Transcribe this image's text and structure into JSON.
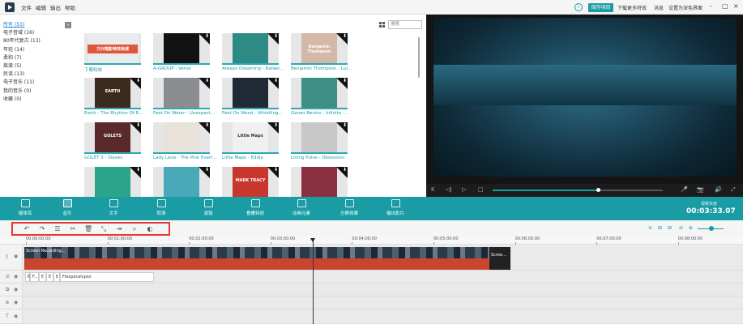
{
  "titlebar": {
    "menu": [
      "文件",
      "编辑",
      "输出",
      "帮助"
    ],
    "info_icon": "i",
    "save_button": "保存项目",
    "links": [
      "下载更多特效",
      "消息",
      "设置为深色界面"
    ],
    "window_controls": [
      "-",
      "□",
      "×"
    ]
  },
  "library": {
    "categories": [
      "所有 (53)",
      "电子音域 (16)",
      "80年代复古 (13)",
      "年轻 (14)",
      "柔和 (7)",
      "摇滚 (5)",
      "民谣 (13)",
      "电子音乐 (11)",
      "我的音乐 (0)",
      "收藏 (0)"
    ],
    "collapse": "«",
    "search_placeholder": "搜索",
    "cards": [
      {
        "title": "下载特效",
        "cover": "万兴喵影特效商城",
        "color": "#e9ecec",
        "download": false
      },
      {
        "title": "A-GROUP - Verve",
        "cover": "",
        "color": "#121212",
        "download": true
      },
      {
        "title": "Always Dreaming - Rafael...",
        "cover": "",
        "color": "#2d8a84",
        "download": true
      },
      {
        "title": "Benjamin Thompson - Lul...",
        "cover": "Benjamin Thompson",
        "color": "#d3b8a8",
        "download": true
      },
      {
        "title": "Earth - The Rhythm Of R...",
        "cover": "EARTH",
        "color": "#3b2a1e",
        "download": true
      },
      {
        "title": "Feet On Water - Unexpect...",
        "cover": "",
        "color": "#8a8e90",
        "download": true
      },
      {
        "title": "Feet On Wood - Whistling...",
        "cover": "",
        "color": "#1f2a36",
        "download": true
      },
      {
        "title": "Garret Bevins - Infinite -...",
        "cover": "",
        "color": "#3c8e86",
        "download": true
      },
      {
        "title": "GOLET S - Slaves",
        "cover": "GOLETS",
        "color": "#5a2a2a",
        "download": true
      },
      {
        "title": "Lady Lane - The Pink Everl...",
        "cover": "",
        "color": "#e8e2d8",
        "download": true
      },
      {
        "title": "Little Maps - Eddie",
        "cover": "Little Maps",
        "color": "#f0f0f0",
        "download": true
      },
      {
        "title": "Living Pulse - Obsession",
        "cover": "",
        "color": "#c7c7c7",
        "download": true
      },
      {
        "title": "",
        "cover": "",
        "color": "#2aa58a",
        "download": true
      },
      {
        "title": "",
        "cover": "",
        "color": "#4aa9b8",
        "download": true
      },
      {
        "title": "",
        "cover": "MARK TRACY",
        "color": "#c8362e",
        "download": true
      },
      {
        "title": "",
        "cover": "",
        "color": "#8a3040",
        "download": true
      }
    ]
  },
  "preview": {
    "controls": [
      "K",
      "◁|",
      "▷",
      "□",
      "🎤",
      "📷",
      "🔊",
      "⤢"
    ],
    "progress": 0.62
  },
  "tabs": [
    {
      "label": "媒体库",
      "icon": "folder-icon",
      "active": false
    },
    {
      "label": "音乐",
      "icon": "music-note-icon",
      "active": true
    },
    {
      "label": "文字",
      "icon": "text-icon",
      "active": false
    },
    {
      "label": "转场",
      "icon": "transition-icon",
      "active": false
    },
    {
      "label": "滤镜",
      "icon": "filter-icon",
      "active": false
    },
    {
      "label": "叠覆特效",
      "icon": "overlay-icon",
      "active": false
    },
    {
      "label": "动画元素",
      "icon": "image-element-icon",
      "active": false
    },
    {
      "label": "分屏效果",
      "icon": "split-screen-icon",
      "active": false
    },
    {
      "label": "输出影片",
      "icon": "export-icon",
      "active": false
    }
  ],
  "duration_label": "视频长度",
  "timecode": "00:03:33.07",
  "toolbar": {
    "tools": [
      "↶",
      "↷",
      "☰",
      "✂",
      "🗑",
      "⤡",
      "⇥",
      "⌕",
      "◐"
    ],
    "right_tools": [
      "≋",
      "⊞",
      "⊞",
      "⊖",
      "⊕"
    ]
  },
  "ruler": [
    "00:00:00:00",
    "00:01:00:00",
    "00:02:00:00",
    "00:03:00:00",
    "00:04:00:00",
    "00:05:00:00",
    "00:06:00:00",
    "00:07:00:00",
    "00:08:00:00"
  ],
  "timeline": {
    "video_clip_label": "Screen Recording...",
    "end_clip_label": "Scree...",
    "text_clips": [
      "E",
      "F...",
      "E",
      "E",
      "E",
      "Flexpocalypso"
    ]
  }
}
